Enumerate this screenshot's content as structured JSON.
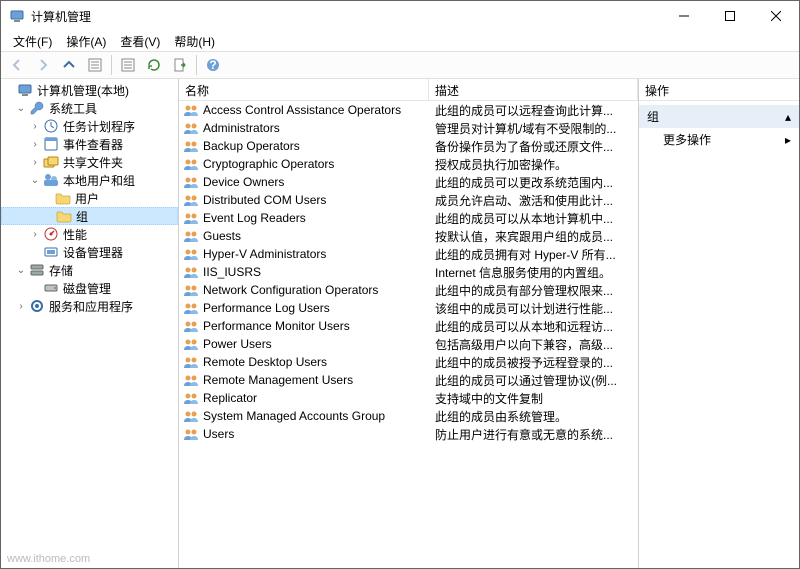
{
  "window": {
    "title": "计算机管理"
  },
  "menu": {
    "file": "文件(F)",
    "action": "操作(A)",
    "view": "查看(V)",
    "help": "帮助(H)"
  },
  "tree": {
    "root": "计算机管理(本地)",
    "system_tools": "系统工具",
    "task_scheduler": "任务计划程序",
    "event_viewer": "事件查看器",
    "shared_folders": "共享文件夹",
    "local_users_groups": "本地用户和组",
    "users": "用户",
    "groups": "组",
    "performance": "性能",
    "device_manager": "设备管理器",
    "storage": "存储",
    "disk_mgmt": "磁盘管理",
    "services_apps": "服务和应用程序"
  },
  "list": {
    "col_name": "名称",
    "col_desc": "描述",
    "rows": [
      {
        "name": "Access Control Assistance Operators",
        "desc": "此组的成员可以远程查询此计算..."
      },
      {
        "name": "Administrators",
        "desc": "管理员对计算机/域有不受限制的..."
      },
      {
        "name": "Backup Operators",
        "desc": "备份操作员为了备份或还原文件..."
      },
      {
        "name": "Cryptographic Operators",
        "desc": "授权成员执行加密操作。"
      },
      {
        "name": "Device Owners",
        "desc": "此组的成员可以更改系统范围内..."
      },
      {
        "name": "Distributed COM Users",
        "desc": "成员允许启动、激活和使用此计..."
      },
      {
        "name": "Event Log Readers",
        "desc": "此组的成员可以从本地计算机中..."
      },
      {
        "name": "Guests",
        "desc": "按默认值，来宾跟用户组的成员..."
      },
      {
        "name": "Hyper-V Administrators",
        "desc": "此组的成员拥有对 Hyper-V 所有..."
      },
      {
        "name": "IIS_IUSRS",
        "desc": "Internet 信息服务使用的内置组。"
      },
      {
        "name": "Network Configuration Operators",
        "desc": "此组中的成员有部分管理权限来..."
      },
      {
        "name": "Performance Log Users",
        "desc": "该组中的成员可以计划进行性能..."
      },
      {
        "name": "Performance Monitor Users",
        "desc": "此组的成员可以从本地和远程访..."
      },
      {
        "name": "Power Users",
        "desc": "包括高级用户以向下兼容，高级..."
      },
      {
        "name": "Remote Desktop Users",
        "desc": "此组中的成员被授予远程登录的..."
      },
      {
        "name": "Remote Management Users",
        "desc": "此组的成员可以通过管理协议(例..."
      },
      {
        "name": "Replicator",
        "desc": "支持域中的文件复制"
      },
      {
        "name": "System Managed Accounts Group",
        "desc": "此组的成员由系统管理。"
      },
      {
        "name": "Users",
        "desc": "防止用户进行有意或无意的系统..."
      }
    ]
  },
  "actions": {
    "header": "操作",
    "group_title": "组",
    "more_actions": "更多操作"
  },
  "watermark": "www.ithome.com"
}
